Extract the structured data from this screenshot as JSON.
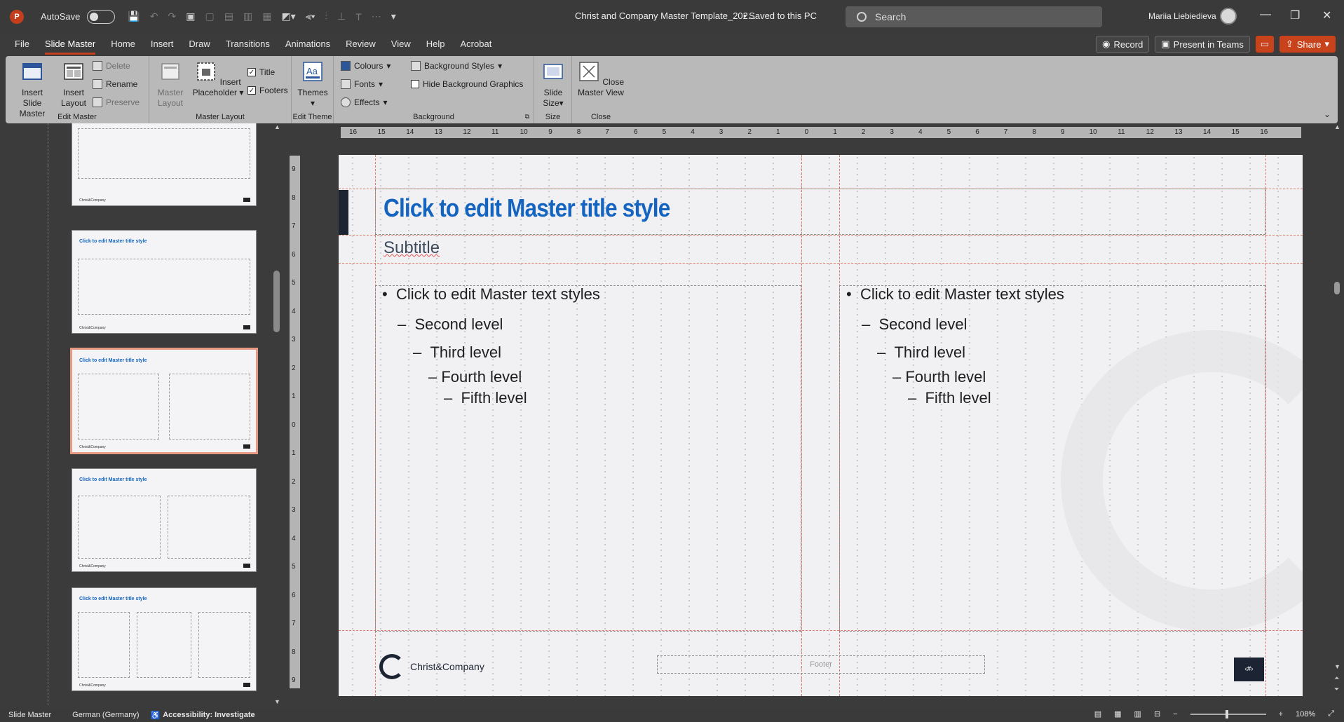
{
  "titlebar": {
    "app_logo": "P",
    "autosave_label": "AutoSave",
    "autosave_state": "Off",
    "doc_title": "Christ and Company Master Template_202...",
    "save_status": "• Saved to this PC",
    "search_placeholder": "Search",
    "user_name": "Mariia Liebiedieva"
  },
  "menu": {
    "tabs": [
      "File",
      "Slide Master",
      "Home",
      "Insert",
      "Draw",
      "Transitions",
      "Animations",
      "Review",
      "View",
      "Help",
      "Acrobat"
    ],
    "active_tab": "Slide Master",
    "record_label": "Record",
    "present_label": "Present in Teams",
    "share_label": "Share"
  },
  "ribbon": {
    "edit_master": {
      "label": "Edit Master",
      "insert_slide_master": "Insert Slide Master",
      "insert_layout": "Insert Layout",
      "delete": "Delete",
      "rename": "Rename",
      "preserve": "Preserve"
    },
    "master_layout": {
      "label": "Master Layout",
      "master_layout_btn": "Master Layout",
      "insert_placeholder": "Insert Placeholder",
      "title_chk": "Title",
      "footers_chk": "Footers"
    },
    "edit_theme": {
      "label": "Edit Theme",
      "themes": "Themes"
    },
    "background": {
      "label": "Background",
      "colours": "Colours",
      "fonts": "Fonts",
      "effects": "Effects",
      "background_styles": "Background Styles",
      "hide_bg_graphics": "Hide Background Graphics"
    },
    "size": {
      "label": "Size",
      "slide_size": "Slide Size"
    },
    "close": {
      "label": "Close",
      "close_master_view": "Close Master View"
    }
  },
  "thumbnails": {
    "title_text": "Click to edit Master title style",
    "footer_text": "Christ&Company"
  },
  "ruler": {
    "h_labels": [
      "16",
      "15",
      "14",
      "13",
      "12",
      "11",
      "10",
      "9",
      "8",
      "7",
      "6",
      "5",
      "4",
      "3",
      "2",
      "1",
      "0",
      "1",
      "2",
      "3",
      "4",
      "5",
      "6",
      "7",
      "8",
      "9",
      "10",
      "11",
      "12",
      "13",
      "14",
      "15",
      "16"
    ],
    "v_labels": [
      "9",
      "8",
      "7",
      "6",
      "5",
      "4",
      "3",
      "2",
      "1",
      "0",
      "1",
      "2",
      "3",
      "4",
      "5",
      "6",
      "7",
      "8",
      "9"
    ]
  },
  "slide": {
    "title": "Click to edit Master title style",
    "subtitle": "Subtitle",
    "left_col": {
      "l1": "Click to edit Master text styles",
      "l2": "Second level",
      "l3": "Third level",
      "l4": "Fourth level",
      "l5": "Fifth level"
    },
    "right_col": {
      "l1": "Click to edit Master text styles",
      "l2": "Second level",
      "l3": "Third level",
      "l4": "Fourth level",
      "l5": "Fifth level"
    },
    "logo_text": "Christ&Company",
    "footer": "Footer",
    "slide_number": "‹#›"
  },
  "status": {
    "view": "Slide Master",
    "language": "German (Germany)",
    "accessibility": "Accessibility: Investigate",
    "zoom": "108%"
  },
  "colors": {
    "accent": "#c43e1c",
    "title_blue": "#1565c0",
    "dark_navy": "#1c2333",
    "guide": "#e07a6a"
  }
}
